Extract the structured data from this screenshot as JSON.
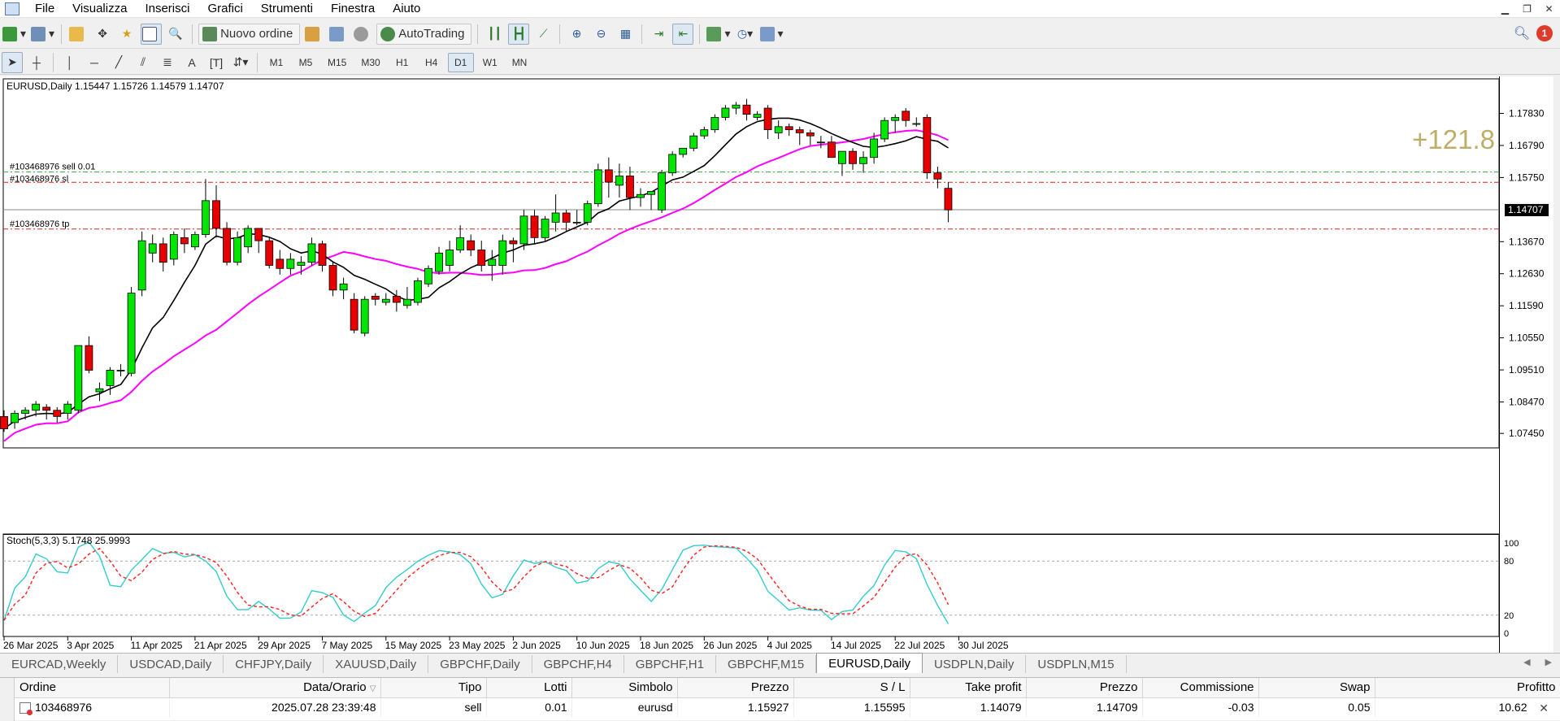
{
  "menu": [
    "File",
    "Visualizza",
    "Inserisci",
    "Grafici",
    "Strumenti",
    "Finestra",
    "Aiuto"
  ],
  "toolbar": {
    "new_order_label": "Nuovo ordine",
    "autotrading_label": "AutoTrading",
    "notification_count": "1"
  },
  "timeframes": [
    "M1",
    "M5",
    "M15",
    "M30",
    "H1",
    "H4",
    "D1",
    "W1",
    "MN"
  ],
  "active_timeframe": "D1",
  "chart": {
    "header": "EURUSD,Daily  1.15447 1.15726 1.14579 1.14707",
    "profit_overlay": "+121.8",
    "current_price_label": "1.14707",
    "lines": {
      "sell": "#103468976 sell 0.01",
      "sl": "#103468976 sl",
      "tp": "#103468976 tp"
    },
    "levels": {
      "sell": 1.15927,
      "sl": 1.15595,
      "tp": 1.14079,
      "current": 1.14707
    },
    "ylabels": [
      "1.17830",
      "1.16790",
      "1.15750",
      "1.14707",
      "1.13670",
      "1.12630",
      "1.11590",
      "1.10550",
      "1.09510",
      "1.08470",
      "1.07450"
    ],
    "xlabels": [
      "26 Mar 2025",
      "3 Apr 2025",
      "11 Apr 2025",
      "21 Apr 2025",
      "29 Apr 2025",
      "7 May 2025",
      "15 May 2025",
      "23 May 2025",
      "2 Jun 2025",
      "10 Jun 2025",
      "18 Jun 2025",
      "26 Jun 2025",
      "4 Jul 2025",
      "14 Jul 2025",
      "22 Jul 2025",
      "30 Jul 2025"
    ],
    "stoch_label": "Stoch(5,3,3) 5.1748 25.9993",
    "stoch_levels": [
      "100",
      "80",
      "20",
      "0"
    ],
    "colors": {
      "bull": "#00e600",
      "bear": "#e60000",
      "ma_fast": "#000000",
      "ma_slow": "#ff00ff",
      "stoch_main": "#33cccc",
      "stoch_signal": "#ff2020",
      "profit": "#bfae6a"
    }
  },
  "chart_data": {
    "type": "candlestick",
    "symbol": "EURUSD",
    "timeframe": "Daily",
    "ylim": [
      1.0735,
      1.1895
    ],
    "ohlc": [
      [
        1.08,
        1.082,
        1.075,
        1.076
      ],
      [
        1.078,
        1.082,
        1.076,
        1.081
      ],
      [
        1.081,
        1.083,
        1.079,
        1.082
      ],
      [
        1.082,
        1.085,
        1.08,
        1.084
      ],
      [
        1.083,
        1.084,
        1.079,
        1.082
      ],
      [
        1.082,
        1.083,
        1.078,
        1.08
      ],
      [
        1.081,
        1.085,
        1.079,
        1.084
      ],
      [
        1.082,
        1.094,
        1.081,
        1.103
      ],
      [
        1.103,
        1.106,
        1.094,
        1.095
      ],
      [
        1.088,
        1.091,
        1.085,
        1.089
      ],
      [
        1.09,
        1.096,
        1.087,
        1.095
      ],
      [
        1.095,
        1.097,
        1.093,
        1.095
      ],
      [
        1.094,
        1.122,
        1.093,
        1.12
      ],
      [
        1.121,
        1.14,
        1.119,
        1.137
      ],
      [
        1.133,
        1.139,
        1.13,
        1.136
      ],
      [
        1.136,
        1.138,
        1.127,
        1.13
      ],
      [
        1.131,
        1.14,
        1.129,
        1.139
      ],
      [
        1.138,
        1.141,
        1.133,
        1.136
      ],
      [
        1.135,
        1.14,
        1.134,
        1.139
      ],
      [
        1.139,
        1.157,
        1.138,
        1.15
      ],
      [
        1.15,
        1.155,
        1.138,
        1.141
      ],
      [
        1.141,
        1.143,
        1.129,
        1.13
      ],
      [
        1.13,
        1.14,
        1.129,
        1.138
      ],
      [
        1.135,
        1.142,
        1.133,
        1.141
      ],
      [
        1.141,
        1.141,
        1.133,
        1.137
      ],
      [
        1.137,
        1.138,
        1.128,
        1.129
      ],
      [
        1.131,
        1.134,
        1.126,
        1.128
      ],
      [
        1.128,
        1.133,
        1.126,
        1.131
      ],
      [
        1.129,
        1.132,
        1.126,
        1.13
      ],
      [
        1.13,
        1.138,
        1.129,
        1.136
      ],
      [
        1.136,
        1.137,
        1.127,
        1.129
      ],
      [
        1.129,
        1.13,
        1.119,
        1.121
      ],
      [
        1.121,
        1.125,
        1.118,
        1.123
      ],
      [
        1.118,
        1.12,
        1.107,
        1.108
      ],
      [
        1.107,
        1.119,
        1.106,
        1.118
      ],
      [
        1.119,
        1.12,
        1.116,
        1.118
      ],
      [
        1.117,
        1.12,
        1.116,
        1.118
      ],
      [
        1.119,
        1.121,
        1.114,
        1.117
      ],
      [
        1.116,
        1.122,
        1.115,
        1.118
      ],
      [
        1.117,
        1.125,
        1.116,
        1.124
      ],
      [
        1.123,
        1.129,
        1.122,
        1.128
      ],
      [
        1.127,
        1.135,
        1.126,
        1.133
      ],
      [
        1.129,
        1.137,
        1.127,
        1.134
      ],
      [
        1.134,
        1.142,
        1.133,
        1.138
      ],
      [
        1.137,
        1.139,
        1.132,
        1.134
      ],
      [
        1.134,
        1.137,
        1.127,
        1.129
      ],
      [
        1.129,
        1.134,
        1.124,
        1.131
      ],
      [
        1.129,
        1.139,
        1.126,
        1.137
      ],
      [
        1.137,
        1.138,
        1.13,
        1.136
      ],
      [
        1.136,
        1.147,
        1.134,
        1.145
      ],
      [
        1.145,
        1.147,
        1.136,
        1.138
      ],
      [
        1.138,
        1.145,
        1.137,
        1.144
      ],
      [
        1.143,
        1.152,
        1.14,
        1.146
      ],
      [
        1.146,
        1.147,
        1.14,
        1.143
      ],
      [
        1.143,
        1.147,
        1.142,
        1.143
      ],
      [
        1.143,
        1.15,
        1.142,
        1.149
      ],
      [
        1.149,
        1.162,
        1.148,
        1.16
      ],
      [
        1.16,
        1.164,
        1.151,
        1.156
      ],
      [
        1.155,
        1.162,
        1.151,
        1.158
      ],
      [
        1.158,
        1.161,
        1.147,
        1.151
      ],
      [
        1.151,
        1.154,
        1.148,
        1.152
      ],
      [
        1.152,
        1.153,
        1.147,
        1.153
      ],
      [
        1.147,
        1.16,
        1.146,
        1.159
      ],
      [
        1.159,
        1.166,
        1.158,
        1.165
      ],
      [
        1.165,
        1.167,
        1.164,
        1.167
      ],
      [
        1.167,
        1.172,
        1.166,
        1.171
      ],
      [
        1.171,
        1.174,
        1.17,
        1.173
      ],
      [
        1.173,
        1.178,
        1.172,
        1.177
      ],
      [
        1.177,
        1.181,
        1.176,
        1.18
      ],
      [
        1.18,
        1.182,
        1.178,
        1.181
      ],
      [
        1.181,
        1.183,
        1.176,
        1.178
      ],
      [
        1.177,
        1.179,
        1.176,
        1.178
      ],
      [
        1.18,
        1.181,
        1.17,
        1.173
      ],
      [
        1.172,
        1.176,
        1.17,
        1.174
      ],
      [
        1.174,
        1.175,
        1.171,
        1.173
      ],
      [
        1.173,
        1.174,
        1.168,
        1.172
      ],
      [
        1.172,
        1.173,
        1.168,
        1.171
      ],
      [
        1.169,
        1.171,
        1.167,
        1.169
      ],
      [
        1.169,
        1.171,
        1.164,
        1.164
      ],
      [
        1.162,
        1.165,
        1.158,
        1.166
      ],
      [
        1.166,
        1.167,
        1.16,
        1.162
      ],
      [
        1.162,
        1.166,
        1.159,
        1.164
      ],
      [
        1.164,
        1.172,
        1.162,
        1.17
      ],
      [
        1.17,
        1.177,
        1.169,
        1.176
      ],
      [
        1.176,
        1.178,
        1.172,
        1.177
      ],
      [
        1.179,
        1.18,
        1.174,
        1.176
      ],
      [
        1.175,
        1.177,
        1.174,
        1.175
      ],
      [
        1.177,
        1.178,
        1.157,
        1.159
      ],
      [
        1.159,
        1.161,
        1.154,
        1.157
      ],
      [
        1.154,
        1.156,
        1.143,
        1.147
      ]
    ],
    "stochastic": {
      "main_last": 5.1748,
      "signal_last": 25.9993,
      "levels": [
        20,
        80
      ]
    }
  },
  "tabs": [
    "EURCAD,Weekly",
    "USDCAD,Daily",
    "CHFJPY,Daily",
    "XAUUSD,Daily",
    "GBPCHF,Daily",
    "GBPCHF,H4",
    "GBPCHF,H1",
    "GBPCHF,M15",
    "EURUSD,Daily",
    "USDPLN,Daily",
    "USDPLN,M15"
  ],
  "active_tab": "EURUSD,Daily",
  "terminal": {
    "columns": [
      "Ordine",
      "Data/Orario",
      "Tipo",
      "Lotti",
      "Simbolo",
      "Prezzo",
      "S / L",
      "Take profit",
      "Prezzo",
      "Commissione",
      "Swap",
      "Profitto"
    ],
    "sorted_column_marker": "▽",
    "rows": [
      [
        "103468976",
        "2025.07.28 23:39:48",
        "sell",
        "0.01",
        "eurusd",
        "1.15927",
        "1.15595",
        "1.14079",
        "1.14709",
        "-0.03",
        "0.05",
        "10.62"
      ]
    ]
  }
}
